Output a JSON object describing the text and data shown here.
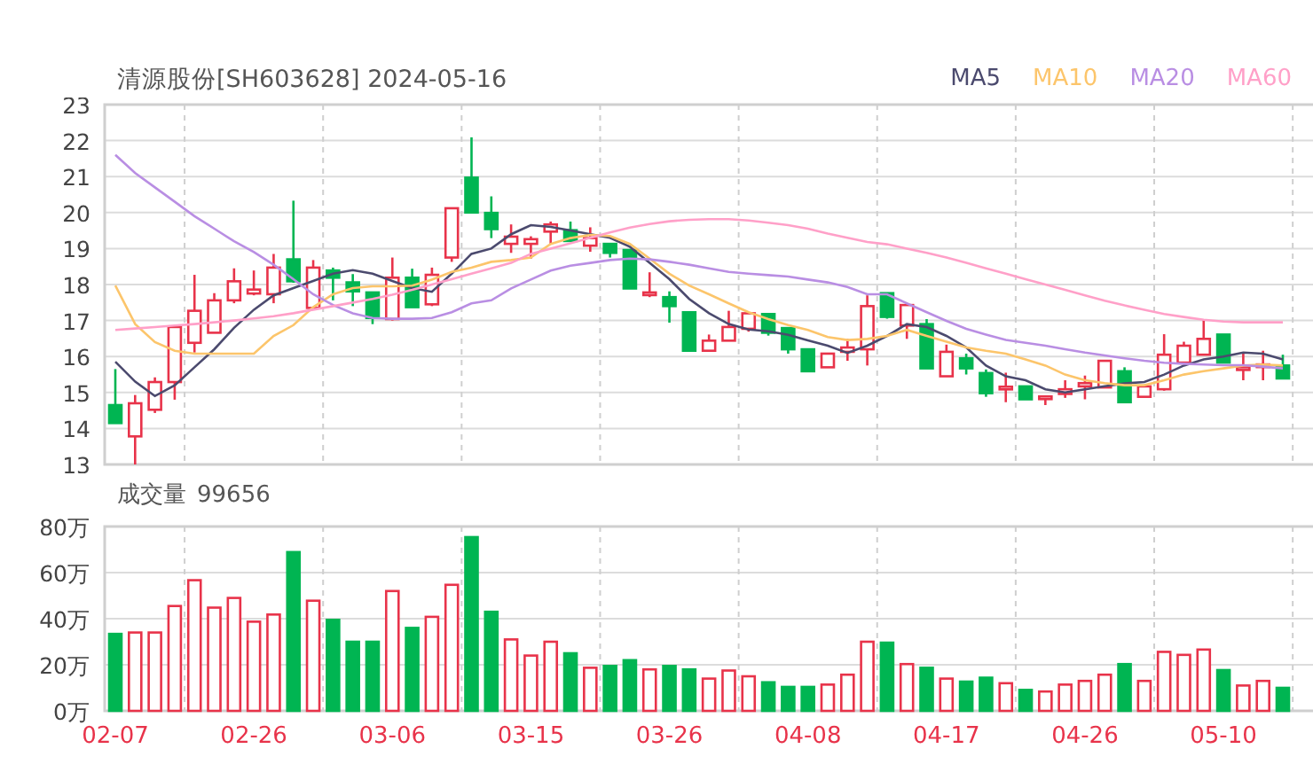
{
  "title": "清源股份[SH603628] 2024-05-16",
  "price_chart": {
    "chart_data": {
      "type": "candlestick",
      "grid": true,
      "ylim": [
        13,
        23
      ],
      "yticks": [
        13,
        14,
        15,
        16,
        17,
        18,
        19,
        20,
        21,
        22,
        23
      ],
      "categories": [
        null,
        null,
        null,
        null,
        null,
        null,
        null,
        null,
        null,
        null,
        null,
        null,
        null,
        null,
        null,
        null,
        null,
        null,
        null,
        null,
        null,
        null,
        null,
        null,
        null,
        null,
        null,
        null,
        null,
        null,
        null,
        null,
        null,
        null,
        null,
        null,
        null,
        null,
        null,
        null,
        null,
        null,
        null,
        null,
        null,
        null,
        null,
        null,
        null,
        null,
        null,
        null,
        null,
        null,
        null,
        null,
        null,
        null,
        null,
        null
      ],
      "ohlc": [
        [
          14.65,
          15.65,
          14.15,
          14.15
        ],
        [
          13.78,
          14.93,
          13.0,
          14.7
        ],
        [
          14.52,
          15.42,
          14.43,
          15.29
        ],
        [
          15.29,
          16.85,
          14.8,
          16.82
        ],
        [
          16.38,
          18.27,
          16.11,
          17.27
        ],
        [
          16.66,
          17.76,
          16.66,
          17.56
        ],
        [
          17.56,
          18.45,
          17.48,
          18.09
        ],
        [
          17.75,
          18.39,
          17.7,
          17.86
        ],
        [
          17.73,
          18.85,
          17.48,
          18.47
        ],
        [
          18.7,
          20.33,
          18.05,
          18.09
        ],
        [
          17.35,
          18.68,
          17.3,
          18.47
        ],
        [
          18.39,
          18.47,
          17.56,
          18.19
        ],
        [
          18.06,
          18.29,
          17.4,
          17.81
        ],
        [
          17.78,
          17.78,
          16.9,
          17.07
        ],
        [
          17.04,
          18.75,
          17.0,
          18.19
        ],
        [
          18.19,
          18.44,
          17.37,
          17.37
        ],
        [
          17.45,
          18.47,
          17.4,
          18.27
        ],
        [
          18.75,
          20.12,
          18.63,
          20.12
        ],
        [
          20.97,
          22.09,
          20.0,
          20.0
        ],
        [
          19.99,
          20.45,
          19.29,
          19.54
        ],
        [
          19.13,
          19.67,
          18.88,
          19.33
        ],
        [
          19.13,
          19.34,
          18.72,
          19.26
        ],
        [
          19.47,
          19.75,
          19.13,
          19.67
        ],
        [
          19.51,
          19.75,
          19.21,
          19.21
        ],
        [
          19.08,
          19.59,
          18.91,
          19.29
        ],
        [
          19.13,
          19.13,
          18.75,
          18.88
        ],
        [
          18.96,
          18.96,
          17.89,
          17.89
        ],
        [
          17.73,
          18.34,
          17.65,
          17.78
        ],
        [
          17.65,
          17.81,
          16.94,
          17.4
        ],
        [
          17.23,
          17.23,
          16.16,
          16.16
        ],
        [
          16.16,
          16.61,
          16.16,
          16.44
        ],
        [
          16.44,
          17.27,
          16.44,
          16.82
        ],
        [
          16.77,
          17.2,
          16.69,
          17.2
        ],
        [
          17.18,
          17.18,
          16.58,
          16.66
        ],
        [
          16.79,
          16.79,
          16.08,
          16.2
        ],
        [
          16.2,
          16.2,
          15.59,
          15.59
        ],
        [
          15.7,
          16.08,
          15.7,
          16.08
        ],
        [
          16.13,
          16.49,
          15.88,
          16.25
        ],
        [
          16.2,
          17.7,
          15.75,
          17.4
        ],
        [
          17.76,
          17.76,
          17.05,
          17.1
        ],
        [
          16.86,
          17.43,
          16.49,
          17.43
        ],
        [
          16.9,
          17.04,
          15.67,
          15.67
        ],
        [
          15.45,
          16.33,
          15.45,
          16.13
        ],
        [
          15.95,
          16.08,
          15.5,
          15.67
        ],
        [
          15.54,
          15.64,
          14.88,
          14.98
        ],
        [
          15.09,
          15.55,
          14.73,
          15.16
        ],
        [
          15.17,
          15.17,
          14.81,
          14.81
        ],
        [
          14.83,
          14.89,
          14.65,
          14.89
        ],
        [
          14.96,
          15.34,
          14.85,
          15.09
        ],
        [
          15.17,
          15.47,
          14.81,
          15.26
        ],
        [
          15.14,
          15.88,
          15.14,
          15.88
        ],
        [
          15.59,
          15.7,
          14.73,
          14.73
        ],
        [
          14.88,
          15.17,
          14.88,
          15.17
        ],
        [
          15.09,
          16.62,
          15.05,
          16.05
        ],
        [
          15.83,
          16.41,
          15.83,
          16.3
        ],
        [
          16.05,
          17.02,
          16.05,
          16.49
        ],
        [
          16.61,
          16.61,
          15.83,
          15.83
        ],
        [
          15.67,
          16.11,
          15.34,
          15.7
        ],
        [
          15.72,
          16.16,
          15.34,
          15.78
        ],
        [
          15.75,
          16.05,
          15.39,
          15.39
        ]
      ],
      "series": [
        {
          "name": "MA5",
          "type": "line",
          "color": "#4b4a6e",
          "values": [
            15.85,
            15.3,
            14.9,
            15.2,
            15.7,
            16.2,
            16.8,
            17.3,
            17.7,
            17.9,
            18.1,
            18.3,
            18.4,
            18.3,
            18.1,
            17.9,
            17.8,
            18.3,
            18.85,
            19.0,
            19.4,
            19.65,
            19.6,
            19.5,
            19.4,
            19.3,
            19.05,
            18.6,
            18.15,
            17.6,
            17.2,
            16.9,
            16.75,
            16.7,
            16.6,
            16.45,
            16.3,
            16.1,
            16.3,
            16.57,
            16.9,
            16.82,
            16.57,
            16.25,
            15.75,
            15.45,
            15.34,
            15.09,
            15.0,
            15.09,
            15.17,
            15.25,
            15.29,
            15.5,
            15.75,
            15.92,
            16.0,
            16.11,
            16.08,
            15.92
          ]
        },
        {
          "name": "MA10",
          "type": "line",
          "color": "#fcc56b",
          "values": [
            17.97,
            16.9,
            16.4,
            16.16,
            16.08,
            16.08,
            16.08,
            16.08,
            16.57,
            16.87,
            17.37,
            17.73,
            17.9,
            17.95,
            17.95,
            17.97,
            18.14,
            18.35,
            18.47,
            18.63,
            18.68,
            18.75,
            19.13,
            19.29,
            19.38,
            19.35,
            19.13,
            18.72,
            18.3,
            17.97,
            17.73,
            17.48,
            17.23,
            17.04,
            16.87,
            16.74,
            16.54,
            16.46,
            16.49,
            16.57,
            16.74,
            16.57,
            16.41,
            16.25,
            16.16,
            16.08,
            15.92,
            15.75,
            15.5,
            15.34,
            15.26,
            15.2,
            15.2,
            15.34,
            15.5,
            15.59,
            15.67,
            15.75,
            15.78,
            15.75
          ]
        },
        {
          "name": "MA20",
          "type": "line",
          "color": "#b98ee3",
          "values": [
            21.6,
            21.1,
            20.7,
            20.3,
            19.9,
            19.55,
            19.2,
            18.9,
            18.55,
            18.15,
            17.73,
            17.43,
            17.2,
            17.07,
            17.05,
            17.05,
            17.07,
            17.23,
            17.48,
            17.56,
            17.89,
            18.14,
            18.39,
            18.52,
            18.6,
            18.68,
            18.72,
            18.7,
            18.63,
            18.55,
            18.45,
            18.35,
            18.3,
            18.26,
            18.22,
            18.14,
            18.06,
            17.93,
            17.73,
            17.73,
            17.48,
            17.23,
            16.99,
            16.77,
            16.61,
            16.46,
            16.38,
            16.3,
            16.2,
            16.11,
            16.03,
            15.95,
            15.88,
            15.83,
            15.8,
            15.78,
            15.76,
            15.76,
            15.72,
            15.67
          ]
        },
        {
          "name": "MA60",
          "type": "line",
          "color": "#ffa0c8",
          "values": [
            16.74,
            16.78,
            16.82,
            16.86,
            16.9,
            16.95,
            17.0,
            17.06,
            17.12,
            17.2,
            17.3,
            17.4,
            17.5,
            17.6,
            17.72,
            17.85,
            18.0,
            18.15,
            18.3,
            18.45,
            18.6,
            18.85,
            19.0,
            19.15,
            19.3,
            19.45,
            19.58,
            19.68,
            19.76,
            19.8,
            19.82,
            19.82,
            19.78,
            19.72,
            19.65,
            19.55,
            19.42,
            19.3,
            19.18,
            19.12,
            19.0,
            18.88,
            18.75,
            18.6,
            18.45,
            18.3,
            18.15,
            18.0,
            17.85,
            17.7,
            17.55,
            17.42,
            17.3,
            17.18,
            17.1,
            17.02,
            16.97,
            16.95,
            16.95,
            16.95
          ]
        }
      ]
    }
  },
  "volume": {
    "label": "成交量",
    "value": "99656",
    "chart_data": {
      "type": "bar",
      "grid": true,
      "ylim": [
        0,
        80
      ],
      "yticks": [
        {
          "value": 0,
          "label": "0万"
        },
        {
          "value": 20,
          "label": "20万"
        },
        {
          "value": 40,
          "label": "40万"
        },
        {
          "value": 60,
          "label": "60万"
        },
        {
          "value": 80,
          "label": "80万"
        }
      ],
      "categories": [
        "02-07",
        null,
        null,
        null,
        null,
        null,
        null,
        "02-26",
        null,
        null,
        null,
        null,
        null,
        null,
        "03-06",
        null,
        null,
        null,
        null,
        null,
        null,
        "03-15",
        null,
        null,
        null,
        null,
        null,
        null,
        "03-26",
        null,
        null,
        null,
        null,
        null,
        null,
        "04-08",
        null,
        null,
        null,
        null,
        null,
        null,
        "04-17",
        null,
        null,
        null,
        null,
        null,
        null,
        "04-26",
        null,
        null,
        null,
        null,
        null,
        null,
        "05-10",
        null,
        null,
        null
      ],
      "values": [
        33.4,
        34,
        34,
        45.5,
        56.7,
        44.8,
        49,
        38.7,
        41.8,
        68.9,
        47.8,
        39.5,
        30,
        30,
        52,
        36,
        40.8,
        54.7,
        75.4,
        43,
        31,
        24,
        30,
        25,
        18.7,
        19.5,
        22,
        18,
        19.5,
        18,
        14,
        17.5,
        15,
        12.4,
        10.4,
        10.4,
        11.4,
        15.7,
        30,
        29.6,
        20.3,
        18.7,
        14,
        12.7,
        14.4,
        12,
        9.1,
        8.4,
        11.4,
        13,
        15.7,
        20.3,
        13,
        25.6,
        24.3,
        26.6,
        17.7,
        11,
        13,
        10
      ]
    }
  }
}
